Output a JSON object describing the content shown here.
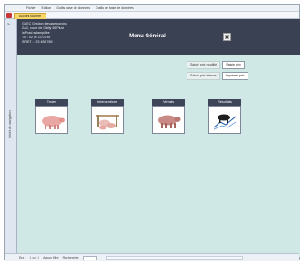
{
  "menu": [
    "Fichier",
    "Edition",
    "Outils base de données",
    "Outils de base de données"
  ],
  "document_tab": "Accueil tournee",
  "nav_pane_label": "Volet de navigation",
  "header": {
    "company_lines": [
      "GAEC Gestion élevage porcins",
      "ZAC, route de Gailly 56 Pluvi",
      "la Prad estampillée",
      "Tél : 02 xx 23 07 xx",
      "SIRET : 123 456 789"
    ],
    "title": "Menu Général"
  },
  "password_rows": [
    {
      "label": "Saisie prix modifié",
      "button": "Saisie prix"
    },
    {
      "label": "Saisie prix interne",
      "button": "Imprimer prix"
    }
  ],
  "tiles": [
    {
      "label": "Truies",
      "icon": "sow-icon"
    },
    {
      "label": "Interventions",
      "icon": "piglets-icon"
    },
    {
      "label": "Verrats",
      "icon": "boar-icon"
    },
    {
      "label": "Résultats",
      "icon": "results-chart-icon"
    }
  ],
  "status": {
    "record_label": "Enr :",
    "record_nav": "1 sur 1",
    "filter_label": "Aucun filtre",
    "search_label": "Rechercher"
  },
  "colors": {
    "header_bg": "#3a4152",
    "form_bg": "#cfe7e5",
    "tile_caption_bg": "#3e4558",
    "pig_pink": "#e9a7a3"
  }
}
